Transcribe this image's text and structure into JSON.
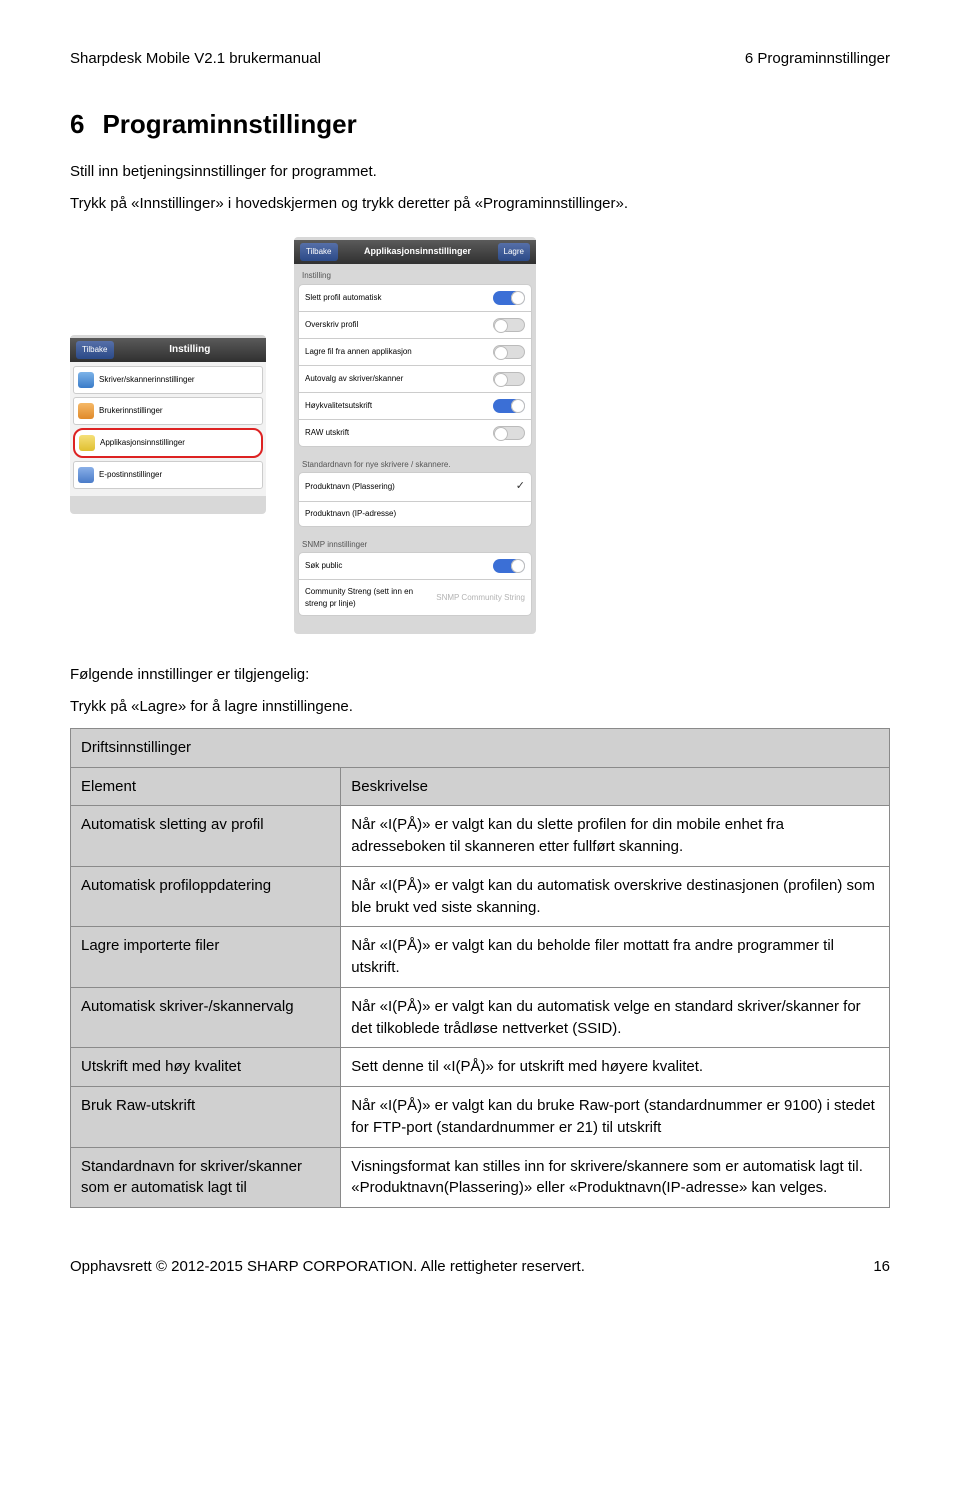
{
  "header": {
    "left": "Sharpdesk Mobile V2.1 brukermanual",
    "right": "6 Programinnstillinger"
  },
  "section": {
    "num": "6",
    "title": "Programinnstillinger",
    "p1": "Still inn betjeningsinnstillinger for programmet.",
    "p2": "Trykk på «Innstillinger» i hovedskjermen og trykk deretter på «Programinnstillinger».",
    "after_shots_1": "Følgende innstillinger er tilgjengelig:",
    "after_shots_2": "Trykk på «Lagre» for å lagre innstillingene."
  },
  "screenshot_left": {
    "back": "Tilbake",
    "title": "Instilling",
    "items": [
      "Skriver/skannerinnstillinger",
      "Brukerinnstillinger",
      "Applikasjonsinnstillinger",
      "E-postinnstillinger"
    ]
  },
  "screenshot_right": {
    "back": "Tilbake",
    "title": "Applikasjonsinnstillinger",
    "save": "Lagre",
    "section1": "Instilling",
    "rows1": [
      {
        "label": "Slett profil automatisk",
        "toggle": "on"
      },
      {
        "label": "Overskriv profil",
        "toggle": "off"
      },
      {
        "label": "Lagre fil fra annen applikasjon",
        "toggle": "off"
      },
      {
        "label": "Autovalg av skriver/skanner",
        "toggle": "off"
      },
      {
        "label": "Høykvalitetsutskrift",
        "toggle": "on"
      },
      {
        "label": "RAW utskrift",
        "toggle": "off"
      }
    ],
    "section2": "Standardnavn for nye skrivere / skannere.",
    "rows2": [
      {
        "label": "Produktnavn (Plassering)",
        "check": true
      },
      {
        "label": "Produktnavn (IP-adresse)",
        "check": false
      }
    ],
    "section3": "SNMP innstillinger",
    "rows3": [
      {
        "label": "Søk public",
        "toggle": "on"
      },
      {
        "label": "Community Streng (sett inn en streng pr linje)",
        "placeholder": "SNMP Community String"
      }
    ]
  },
  "table": {
    "caption": "Driftsinnstillinger",
    "head_element": "Element",
    "head_desc": "Beskrivelse",
    "rows": [
      {
        "el": "Automatisk sletting av profil",
        "desc": "Når «I(PÅ)» er valgt kan du slette profilen for din mobile enhet fra adresseboken til skanneren etter fullført skanning."
      },
      {
        "el": "Automatisk profiloppdatering",
        "desc": "Når «I(PÅ)» er valgt kan du automatisk overskrive destinasjonen (profilen) som ble brukt ved siste skanning."
      },
      {
        "el": "Lagre importerte filer",
        "desc": "Når «I(PÅ)» er valgt kan du beholde filer mottatt fra andre programmer til utskrift."
      },
      {
        "el": "Automatisk skriver-/skannervalg",
        "desc": "Når «I(PÅ)» er valgt kan du automatisk velge en standard skriver/skanner for det tilkoblede trådløse nettverket (SSID)."
      },
      {
        "el": "Utskrift med høy kvalitet",
        "desc": "Sett denne til «I(PÅ)» for utskrift med høyere kvalitet."
      },
      {
        "el": "Bruk Raw-utskrift",
        "desc": "Når «I(PÅ)» er valgt kan du bruke Raw-port (standardnummer er 9100) i stedet for FTP-port (standardnummer er 21) til utskrift"
      },
      {
        "el": "Standardnavn for skriver/skanner som er automatisk lagt til",
        "desc": "Visningsformat kan stilles inn for skrivere/skannere som er automatisk lagt til. «Produktnavn(Plassering)» eller «Produktnavn(IP-adresse» kan velges."
      }
    ]
  },
  "footer": {
    "copyright": "Opphavsrett © 2012-2015 SHARP CORPORATION. Alle rettigheter reservert.",
    "page": "16"
  }
}
